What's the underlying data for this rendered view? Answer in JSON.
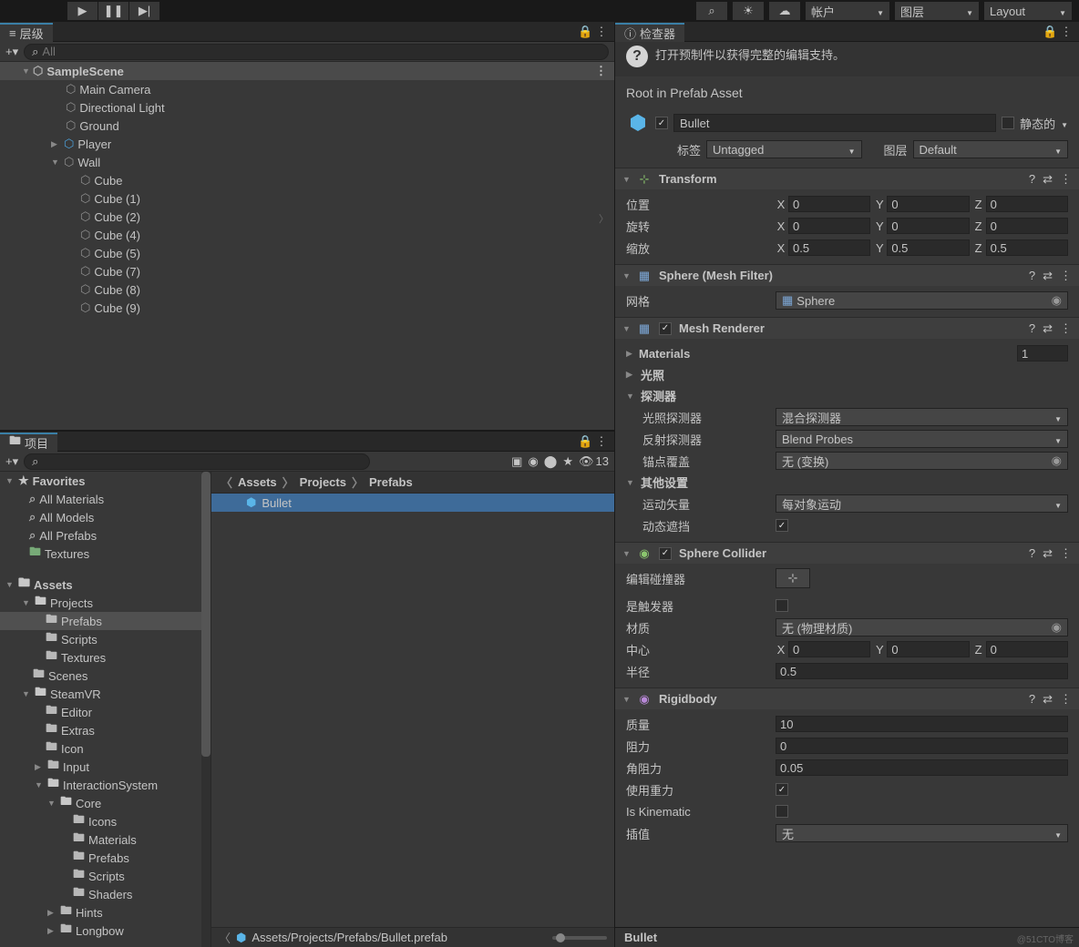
{
  "topbar": {
    "account": "帐户",
    "layers": "图层",
    "layout": "Layout"
  },
  "hierarchy": {
    "title": "层级",
    "search_ph": "All",
    "scene": "SampleScene",
    "items": [
      "Main Camera",
      "Directional Light",
      "Ground"
    ],
    "player": "Player",
    "wall": "Wall",
    "cubes": [
      "Cube",
      "Cube (1)",
      "Cube (2)",
      "Cube (4)",
      "Cube (5)",
      "Cube (7)",
      "Cube (8)",
      "Cube (9)"
    ]
  },
  "project": {
    "title": "项目",
    "hidden_count": "13",
    "favorites": "Favorites",
    "fav_items": [
      "All Materials",
      "All Models",
      "All Prefabs"
    ],
    "textures_fav": "Textures",
    "assets": "Assets",
    "projects": "Projects",
    "prefabs": "Prefabs",
    "scripts": "Scripts",
    "textures": "Textures",
    "scenes": "Scenes",
    "steamvr": "SteamVR",
    "editor": "Editor",
    "extras": "Extras",
    "icon": "Icon",
    "input": "Input",
    "interaction": "InteractionSystem",
    "core": "Core",
    "core_items": [
      "Icons",
      "Materials",
      "Prefabs",
      "Scripts",
      "Shaders"
    ],
    "hints": "Hints",
    "longbow": "Longbow",
    "breadcrumb": [
      "Assets",
      "Projects",
      "Prefabs"
    ],
    "item": "Bullet",
    "path": "Assets/Projects/Prefabs/Bullet.prefab"
  },
  "inspector": {
    "title": "检查器",
    "banner": "打开预制件以获得完整的编辑支持。",
    "root_label": "Root in Prefab Asset",
    "obj_name": "Bullet",
    "static": "静态的",
    "tag_l": "标签",
    "tag": "Untagged",
    "layer_l": "图层",
    "layer": "Default",
    "transform": {
      "title": "Transform",
      "pos": "位置",
      "rot": "旋转",
      "scale": "缩放",
      "pos_v": {
        "x": "0",
        "y": "0",
        "z": "0"
      },
      "rot_v": {
        "x": "0",
        "y": "0",
        "z": "0"
      },
      "scale_v": {
        "x": "0.5",
        "y": "0.5",
        "z": "0.5"
      }
    },
    "meshfilter": {
      "title": "Sphere (Mesh Filter)",
      "mesh_l": "网格",
      "mesh": "Sphere"
    },
    "renderer": {
      "title": "Mesh Renderer",
      "materials": "Materials",
      "mat_count": "1",
      "lighting": "光照",
      "probes": "探测器",
      "light_probe_l": "光照探测器",
      "light_probe": "混合探测器",
      "refl_probe_l": "反射探测器",
      "refl_probe": "Blend Probes",
      "anchor_l": "锚点覆盖",
      "anchor": "无 (变换)",
      "additional": "其他设置",
      "motion_l": "运动矢量",
      "motion": "每对象运动",
      "occlusion": "动态遮挡"
    },
    "collider": {
      "title": "Sphere Collider",
      "edit": "编辑碰撞器",
      "trigger": "是触发器",
      "material_l": "材质",
      "material": "无 (物理材质)",
      "center": "中心",
      "radius": "半径",
      "radius_v": "0.5",
      "center_v": {
        "x": "0",
        "y": "0",
        "z": "0"
      }
    },
    "rigidbody": {
      "title": "Rigidbody",
      "mass": "质量",
      "mass_v": "10",
      "drag": "阻力",
      "drag_v": "0",
      "adrag": "角阻力",
      "adrag_v": "0.05",
      "gravity": "使用重力",
      "kinematic": "Is Kinematic",
      "interp_l": "插值",
      "interp": "无"
    },
    "footer": "Bullet"
  },
  "watermark": "@51CTO博客"
}
